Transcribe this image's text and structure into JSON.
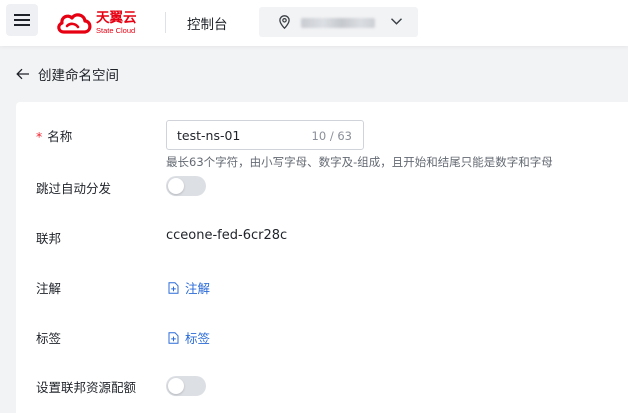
{
  "header": {
    "logo_cn": "天翼云",
    "logo_en": "State Cloud",
    "console_label": "控制台",
    "brand_color": "#e60012"
  },
  "breadcrumb": {
    "title": "创建命名空间"
  },
  "form": {
    "name": {
      "required_mark": "*",
      "label": "名称",
      "value": "test-ns-01",
      "counter": "10 / 63",
      "hint": "最长63个字符，由小写字母、数字及-组成，且开始和结尾只能是数字和字母"
    },
    "skip_auto_distribute": {
      "label": "跳过自动分发",
      "enabled": false
    },
    "federation": {
      "label": "联邦",
      "value": "cceone-fed-6cr28c"
    },
    "annotations": {
      "label": "注解",
      "link": "注解"
    },
    "tags": {
      "label": "标签",
      "link": "标签"
    },
    "federation_quota": {
      "label": "设置联邦资源配额",
      "enabled": false
    }
  },
  "colors": {
    "link": "#2b6bd8",
    "required": "#f5222d",
    "switch_off": "#dcdfe4"
  }
}
